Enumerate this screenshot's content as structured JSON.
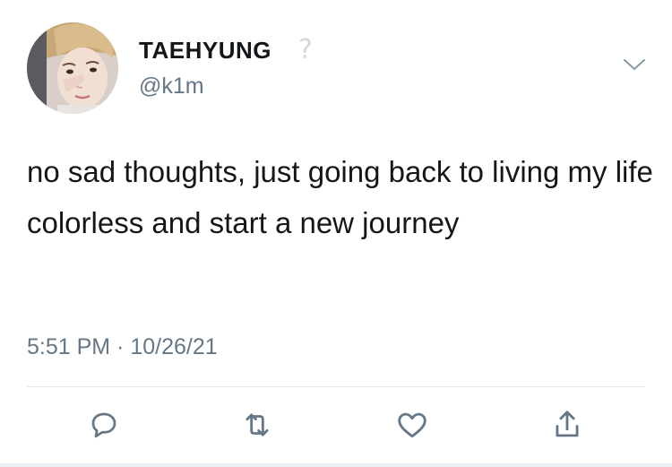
{
  "user": {
    "display_name": "TAEHYUNG",
    "name_emoji": "?",
    "handle": "@k1m",
    "avatar_icon": "profile-photo"
  },
  "tweet": {
    "text": "no sad thoughts, just going back to living my life colorless and start a new journey",
    "timestamp": "5:51 PM · 10/26/21"
  },
  "header": {
    "menu_icon": "chevron-down-icon"
  },
  "actions": [
    {
      "name": "reply",
      "icon": "reply-icon"
    },
    {
      "name": "retweet",
      "icon": "retweet-icon"
    },
    {
      "name": "like",
      "icon": "heart-icon"
    },
    {
      "name": "share",
      "icon": "share-icon"
    }
  ],
  "colors": {
    "text": "#14171a",
    "secondary": "#657786",
    "icon": "#657786",
    "divider": "#e1e8ed"
  }
}
